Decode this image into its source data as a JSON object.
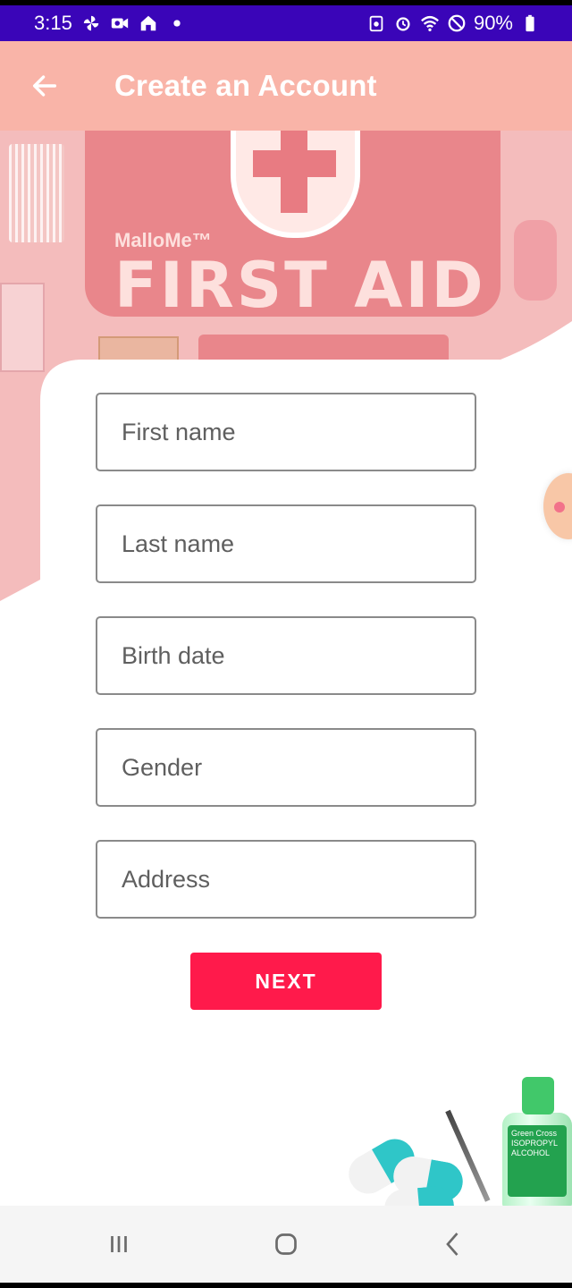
{
  "status_bar": {
    "time": "3:15",
    "battery": "90%",
    "left_icons": [
      "pinwheel-icon",
      "video-camera-icon",
      "home-icon",
      "dot-icon"
    ],
    "right_icons": [
      "sync-icon",
      "alarm-icon",
      "wifi-icon",
      "do-not-disturb-icon",
      "battery-icon"
    ],
    "bg_color": "#3a05b8"
  },
  "app_bar": {
    "title": "Create an Account",
    "back_icon": "arrow-left-icon",
    "bg_color": "#f9b4a8"
  },
  "hero": {
    "brand": "MalloMe™",
    "bag_text": "FIRST AID"
  },
  "form": {
    "fields": [
      {
        "name": "first-name-field",
        "placeholder": "First name",
        "value": ""
      },
      {
        "name": "last-name-field",
        "placeholder": "Last name",
        "value": ""
      },
      {
        "name": "birth-date-field",
        "placeholder": "Birth date",
        "value": ""
      },
      {
        "name": "gender-field",
        "placeholder": "Gender",
        "value": ""
      },
      {
        "name": "address-field",
        "placeholder": "Address",
        "value": ""
      }
    ],
    "next_label": "NEXT",
    "accent_color": "#ff1a4b"
  },
  "decor": {
    "bottle_label": "Green Cross ISOPROPYL ALCOHOL"
  },
  "nav_bar": {
    "buttons": [
      "recent-apps-icon",
      "home-icon",
      "back-icon"
    ]
  }
}
